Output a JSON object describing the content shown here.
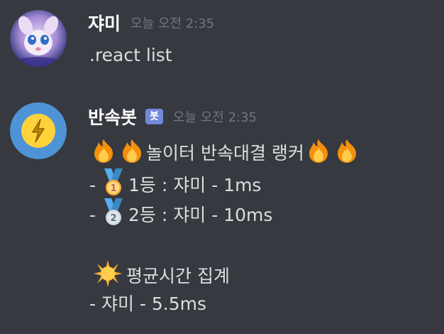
{
  "messages": [
    {
      "username": "쟈미",
      "timestamp": "오늘 오전 2:35",
      "content": ".react list"
    },
    {
      "username": "반속봇",
      "bot_tag": "봇",
      "timestamp": "오늘 오전 2:35",
      "title": "놀이터 반속대결 랭커",
      "rank1": "1등 : 쟈미 - 1ms",
      "rank2": "2등 : 쟈미 - 10ms",
      "avg_title": "평균시간 집계",
      "avg_line": "- 쟈미 - 5.5ms",
      "dash": "-"
    }
  ],
  "icons": {
    "fire": "fire-icon",
    "medal1": "first-place-medal-icon",
    "medal2": "second-place-medal-icon",
    "sun": "sun-icon",
    "bot_avatar": "lightning-icon"
  },
  "colors": {
    "background": "#36393f",
    "username": "#ffffff",
    "text": "#dcddde",
    "timestamp": "#72767d",
    "bot_tag": "#7289da",
    "bot_avatar": "#4e93d6"
  }
}
